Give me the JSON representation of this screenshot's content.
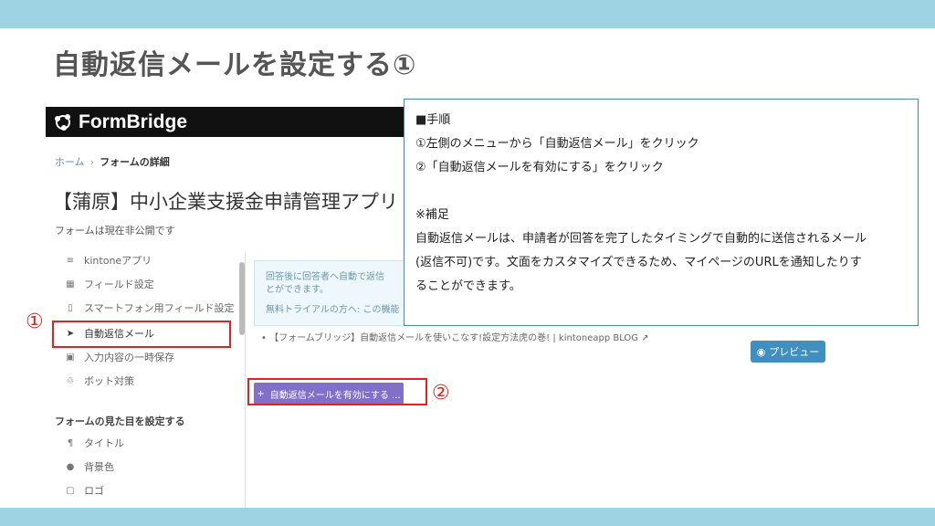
{
  "slide": {
    "title": "自動返信メールを設定する①",
    "band_color": "#9dd3e2"
  },
  "screenshot": {
    "logo_text": "FormBridge",
    "breadcrumb": {
      "home": "ホーム",
      "current": "フォームの詳細"
    },
    "app_title": "【蒲原】中小企業支援金申請管理アプリ",
    "form_status": "フォームは現在非公開です",
    "sidebar": {
      "items": [
        {
          "label": "kintoneアプリ",
          "icon": "database-icon"
        },
        {
          "label": "フィールド設定",
          "icon": "grid-icon"
        },
        {
          "label": "スマートフォン用フィールド設定",
          "icon": "smartphone-icon"
        },
        {
          "label": "自動返信メール",
          "icon": "paper-plane-icon"
        },
        {
          "label": "入力内容の一時保存",
          "icon": "save-icon"
        },
        {
          "label": "ボット対策",
          "icon": "recycle-icon"
        }
      ],
      "heading": "フォームの見た目を設定する",
      "style_items": [
        {
          "label": "タイトル",
          "icon": "pilcrow-icon"
        },
        {
          "label": "背景色",
          "icon": "drop-icon"
        },
        {
          "label": "ロゴ",
          "icon": "image-icon"
        }
      ]
    },
    "info_box": {
      "line1": "回答後に回答者へ自動で返信",
      "line2": "とができます。",
      "line3": "無料トライアルの方へ: この機能"
    },
    "link_text": "【フォームブリッジ】自動返信メールを使いこなす!設定方法虎の巻! | kintoneapp BLOG",
    "preview_label": "プレビュー",
    "enable_label": "自動返信メールを有効にする ..."
  },
  "markers": {
    "one": "①",
    "two": "②",
    "highlight_color": "#e52020"
  },
  "note": {
    "heading": "■手順",
    "step1": "①左側のメニューから「自動返信メール」をクリック",
    "step2": "②「自動返信メールを有効にする」をクリック",
    "supplement_heading": "※補足",
    "supplement_line1": "自動返信メールは、申請者が回答を完了したタイミングで自動的に送信されるメール",
    "supplement_line2": "(返信不可)です。文面をカスタマイズできるため、マイページのURLを通知したりす",
    "supplement_line3": "ることができます。"
  }
}
